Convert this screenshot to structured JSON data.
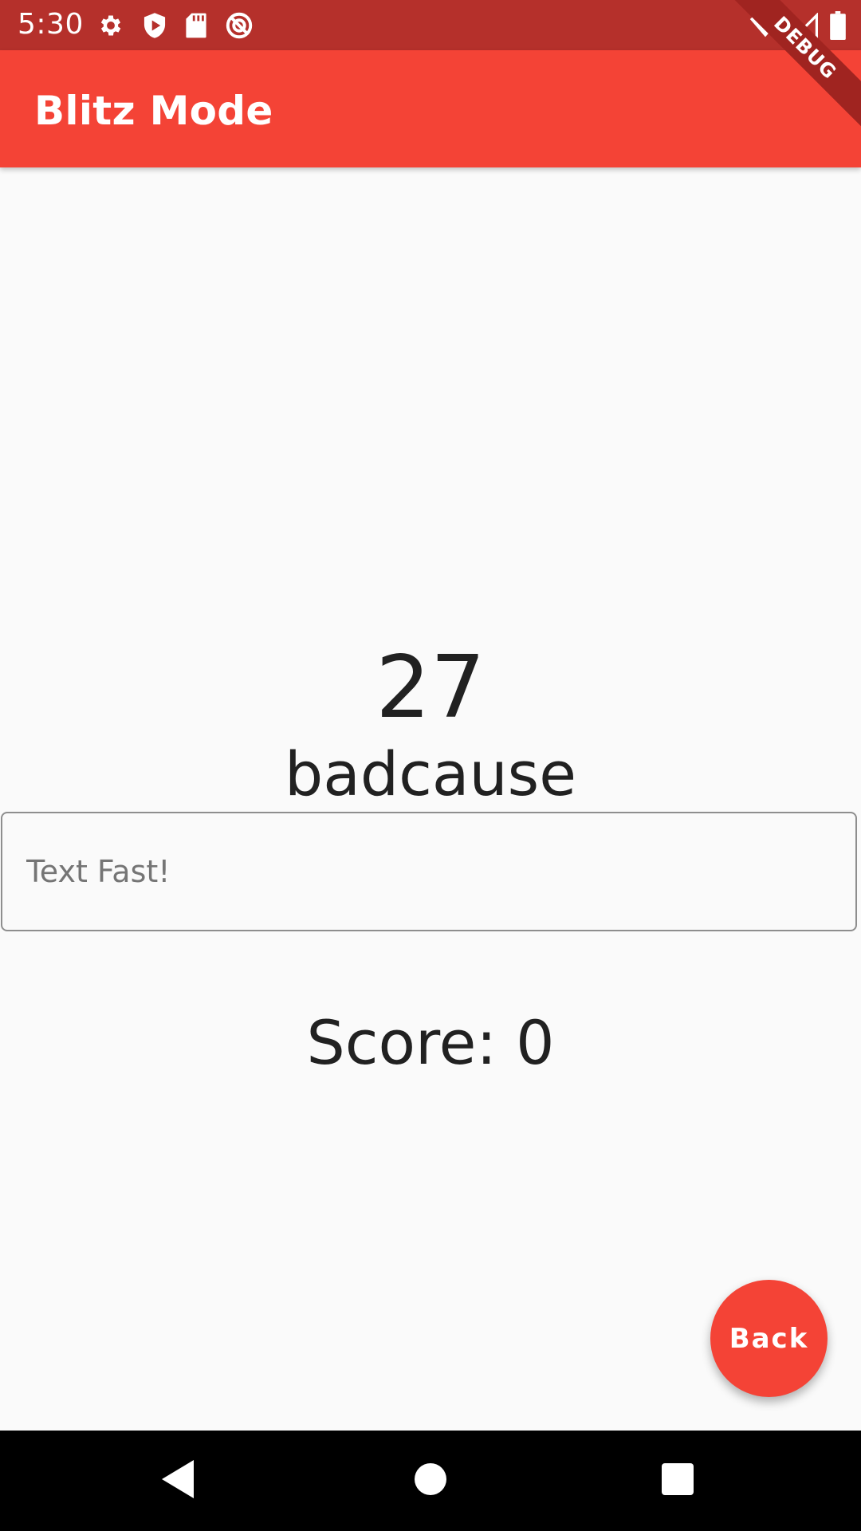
{
  "status_bar": {
    "time": "5:30",
    "icons_left": [
      "settings-icon",
      "shield-play-icon",
      "sd-card-icon",
      "blocked-circle-icon"
    ],
    "icons_right": [
      "wifi-icon",
      "signal-icon",
      "battery-icon"
    ]
  },
  "app_bar": {
    "title": "Blitz Mode",
    "color": "#f44336"
  },
  "debug_banner": {
    "label": "DEBUG"
  },
  "game": {
    "timer": "27",
    "word": "badcause",
    "input": {
      "value": "",
      "placeholder": "Text Fast!"
    },
    "score_text": "Score: 0"
  },
  "fab": {
    "label": "Back",
    "color": "#f44336"
  },
  "nav_bar": {
    "buttons": [
      "back-triangle-icon",
      "home-circle-icon",
      "recents-square-icon"
    ]
  }
}
